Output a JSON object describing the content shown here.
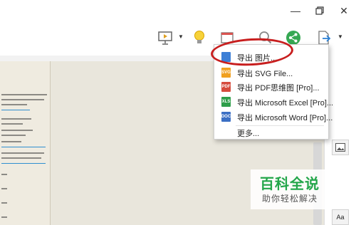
{
  "export_menu": {
    "items": [
      {
        "label": "导出 图片...",
        "icon": "image-file-icon",
        "color": "#3d7fd6"
      },
      {
        "label": "导出 SVG File...",
        "icon": "svg-file-icon",
        "color": "#f0a020"
      },
      {
        "label": "导出 PDF思维图 [Pro]...",
        "icon": "pdf-file-icon",
        "color": "#d64b3d"
      },
      {
        "label": "导出 Microsoft Excel [Pro]...",
        "icon": "excel-file-icon",
        "color": "#2e9e4a"
      },
      {
        "label": "导出 Microsoft Word [Pro]...",
        "icon": "word-file-icon",
        "color": "#3b6fc4"
      }
    ],
    "more_label": "更多..."
  },
  "icon_badges": {
    "svg": "SVG",
    "pdf": "PDF",
    "xls": "XLS",
    "doc": "DOC"
  },
  "side_panel": {
    "text_style_label": "Aa"
  },
  "watermark": {
    "title": "百科全说",
    "subtitle": "助你轻松解决"
  },
  "colors": {
    "highlight_circle": "#c81e1e",
    "watermark_green": "#23a64a",
    "share_green": "#36a853"
  }
}
